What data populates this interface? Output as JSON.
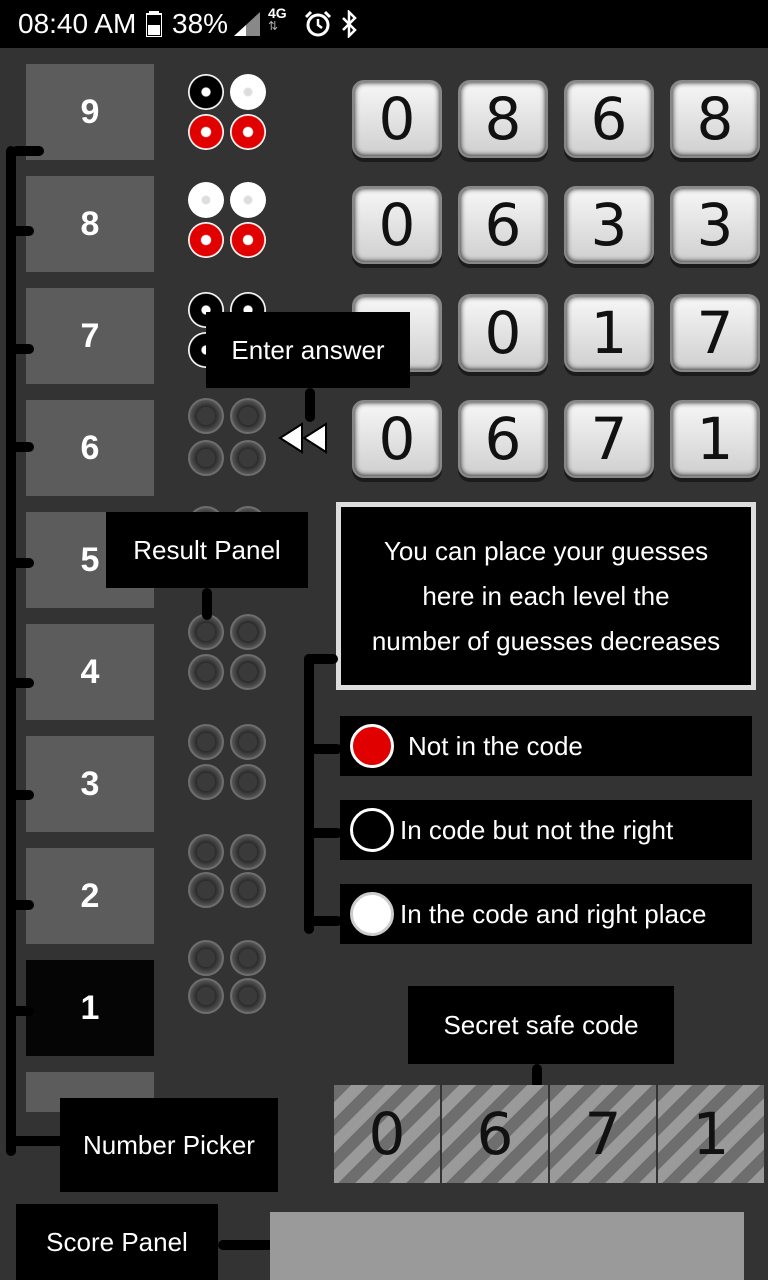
{
  "status_bar": {
    "time": "08:40 AM",
    "battery": "38%",
    "network": "4G",
    "icons": [
      "battery-icon",
      "signal-icon",
      "network-4g-icon",
      "alarm-icon",
      "bluetooth-icon"
    ]
  },
  "number_picker": {
    "values": [
      "9",
      "8",
      "7",
      "6",
      "5",
      "4",
      "3",
      "2",
      "1"
    ],
    "selected": "1"
  },
  "guesses": [
    {
      "level": "9",
      "digits": [
        "0",
        "8",
        "6",
        "8"
      ],
      "result": [
        "black",
        "white",
        "red",
        "red"
      ]
    },
    {
      "level": "8",
      "digits": [
        "0",
        "6",
        "3",
        "3"
      ],
      "result": [
        "white",
        "white",
        "red",
        "red"
      ]
    },
    {
      "level": "7",
      "digits": [
        "",
        "0",
        "1",
        "7"
      ],
      "result": [
        "black",
        "black",
        "black",
        "empty"
      ]
    },
    {
      "level": "6",
      "digits": [
        "0",
        "6",
        "7",
        "1"
      ],
      "result": [
        "empty",
        "empty",
        "empty",
        "empty"
      ]
    }
  ],
  "annotations": {
    "enter_answer": "Enter answer",
    "result_panel": "Result Panel",
    "info": [
      "You can place your guesses",
      "here in each level the",
      "number of guesses  decreases"
    ],
    "secret_code_label": "Secret safe code",
    "number_picker_label": "Number Picker",
    "score_panel_label": "Score Panel"
  },
  "legend": {
    "not_in_code": "Not in the code",
    "in_code_wrong_place": "In code but not the right",
    "in_code_right_place": "In the code and right place"
  },
  "secret_code": [
    "0",
    "6",
    "7",
    "1"
  ],
  "colors": {
    "background": "#333333",
    "picker_tile": "#5c5c5c",
    "peg_red": "#e00000",
    "score_bar": "#9a9a9a"
  }
}
